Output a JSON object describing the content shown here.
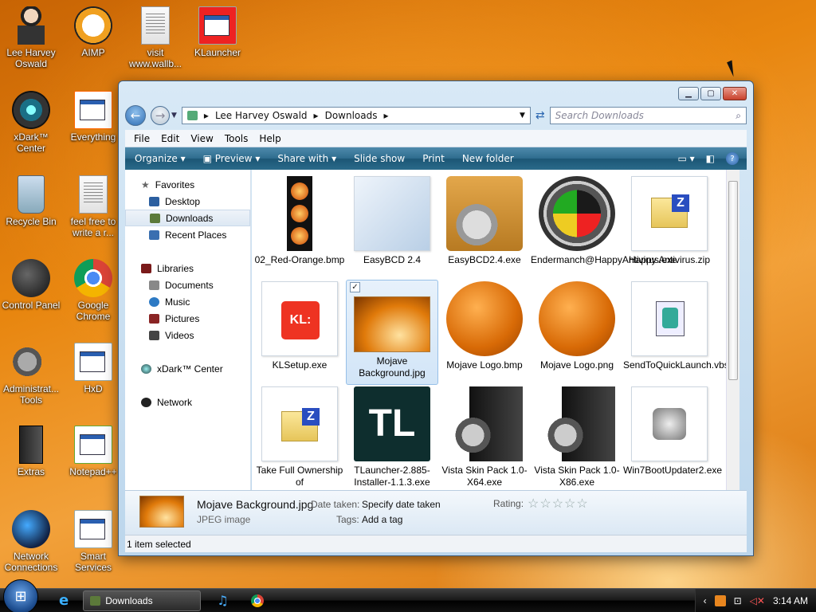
{
  "desktop": {
    "icons": [
      {
        "label": "Lee Harvey Oswald"
      },
      {
        "label": "AIMP"
      },
      {
        "label": "visit www.wallb..."
      },
      {
        "label": "KLauncher"
      },
      {
        "label": "xDark™ Center"
      },
      {
        "label": "Everything"
      },
      {
        "label": "Recycle Bin"
      },
      {
        "label": "feel free to write a r..."
      },
      {
        "label": "Control Panel"
      },
      {
        "label": "Google Chrome"
      },
      {
        "label": "Administrat... Tools"
      },
      {
        "label": "HxD"
      },
      {
        "label": "Extras"
      },
      {
        "label": "Notepad++"
      },
      {
        "label": "Network Connections"
      },
      {
        "label": "Smart Services"
      }
    ]
  },
  "window": {
    "address": {
      "crumb1": "Lee Harvey Oswald",
      "crumb2": "Downloads"
    },
    "search_placeholder": "Search Downloads",
    "menu": [
      "File",
      "Edit",
      "View",
      "Tools",
      "Help"
    ],
    "toolbar": {
      "organize": "Organize",
      "preview": "Preview",
      "share_with": "Share with",
      "slide_show": "Slide show",
      "print": "Print",
      "new_folder": "New folder"
    },
    "nav": {
      "favorites": "Favorites",
      "desktop": "Desktop",
      "downloads": "Downloads",
      "recent_places": "Recent Places",
      "libraries": "Libraries",
      "documents": "Documents",
      "music": "Music",
      "pictures": "Pictures",
      "videos": "Videos",
      "xdark_center": "xDark™ Center",
      "network": "Network"
    },
    "files": [
      {
        "name": "02_Red-Orange.bmp"
      },
      {
        "name": "EasyBCD 2.4"
      },
      {
        "name": "EasyBCD2.4.exe"
      },
      {
        "name": "Endermanch@HappyAntivirus.exe"
      },
      {
        "name": "Happy Antivirus.zip"
      },
      {
        "name": "KLSetup.exe"
      },
      {
        "name": "Mojave Background.jpg"
      },
      {
        "name": "Mojave Logo.bmp"
      },
      {
        "name": "Mojave Logo.png"
      },
      {
        "name": "SendToQuickLaunch.vbs"
      },
      {
        "name": "Take Full Ownership of"
      },
      {
        "name": "TLauncher-2.885-Installer-1.1.3.exe"
      },
      {
        "name": "Vista Skin Pack 1.0-X64.exe"
      },
      {
        "name": "Vista Skin Pack 1.0-X86.exe"
      },
      {
        "name": "Win7BootUpdater2.exe"
      }
    ],
    "details": {
      "filename": "Mojave Background.jpg",
      "filetype": "JPEG image",
      "date_label": "Date taken:",
      "date_value": "Specify date taken",
      "tags_label": "Tags:",
      "tags_value": "Add a tag",
      "rating_label": "Rating:",
      "rating_stars": "☆☆☆☆☆"
    },
    "status": "1 item selected"
  },
  "taskbar": {
    "active_window": "Downloads",
    "clock": "3:14 AM"
  }
}
